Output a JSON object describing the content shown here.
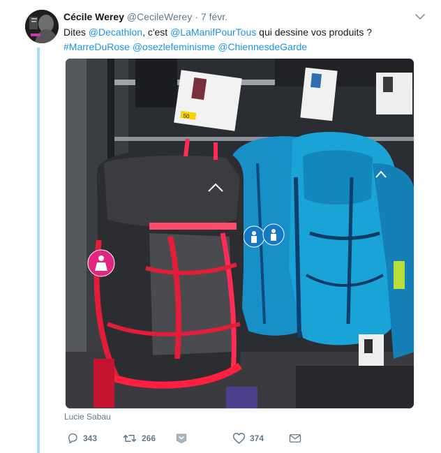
{
  "tweet": {
    "author_name": "Cécile Werey",
    "author_handle": "@CecileWerey",
    "separator": "·",
    "date": "7 févr.",
    "text": {
      "t1": "Dites ",
      "m1": "@Decathlon",
      "t2": ", c'est ",
      "m2": "@LaManifPourTous",
      "t3": " qui dessine vos produits ?",
      "h1": "#MarreDuRose",
      "m3": "@osezlefeminisme",
      "m4": "@ChiennesdeGarde"
    },
    "photo_credit": "Lucie Sabau",
    "media_tag": "50"
  },
  "actions": {
    "reply_count": "343",
    "retweet_count": "266",
    "like_count": "374"
  },
  "colors": {
    "accent": "#1b95e0",
    "muted": "#657786",
    "thread_line": "#a7dcfb"
  },
  "icons": {
    "reply": "reply-icon",
    "retweet": "retweet-icon",
    "moments": "moments-icon",
    "like": "heart-icon",
    "dm": "envelope-icon",
    "caret": "chevron-down-icon"
  }
}
